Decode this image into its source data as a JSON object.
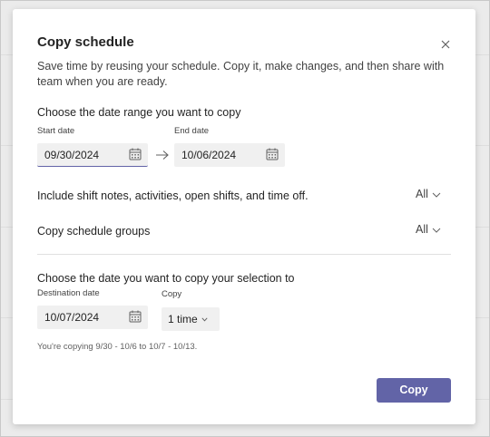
{
  "dialog": {
    "title": "Copy schedule",
    "description": "Save time by reusing your schedule. Copy it, make changes, and then share with team when you are ready."
  },
  "date_range": {
    "heading": "Choose the date range you want to copy",
    "start_label": "Start date",
    "start_value": "09/30/2024",
    "end_label": "End date",
    "end_value": "10/06/2024"
  },
  "options": {
    "include_label": "Include shift notes, activities, open shifts, and time off.",
    "include_value": "All",
    "groups_label": "Copy schedule groups",
    "groups_value": "All"
  },
  "destination": {
    "heading": "Choose the date you want to copy your selection to",
    "date_label": "Destination date",
    "date_value": "10/07/2024",
    "copy_label": "Copy",
    "copy_value": "1 time",
    "summary": "You're copying 9/30 - 10/6 to 10/7 - 10/13."
  },
  "actions": {
    "copy_button": "Copy"
  },
  "colors": {
    "accent": "#6264a7",
    "field_bg": "#f0f0f0",
    "backdrop": "#ebebeb"
  },
  "icons": [
    "close-icon",
    "calendar-icon",
    "arrow-right-icon",
    "chevron-down-icon"
  ]
}
